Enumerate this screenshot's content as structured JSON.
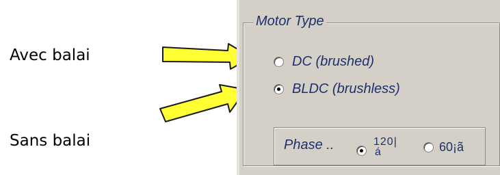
{
  "annotations": {
    "avec_balai": "Avec balai",
    "sans_balai": "Sans balai"
  },
  "motor_type": {
    "title": "Motor Type",
    "options": [
      {
        "label": "DC (brushed)",
        "checked": false
      },
      {
        "label": "BLDC (brushless)",
        "checked": true
      }
    ]
  },
  "phase": {
    "label": "Phase ..",
    "option_120_top": "120|",
    "option_120_bottom": "á",
    "option_120_checked": true,
    "option_60": "60¡ã",
    "option_60_checked": false
  },
  "colors": {
    "panel_bg": "#d4d0c8",
    "label_text": "#1e2f6e",
    "arrow_fill": "#ffff33",
    "arrow_outline": "#1a1a1a"
  },
  "icons": [
    "arrow-right-icon",
    "radio-icon"
  ]
}
